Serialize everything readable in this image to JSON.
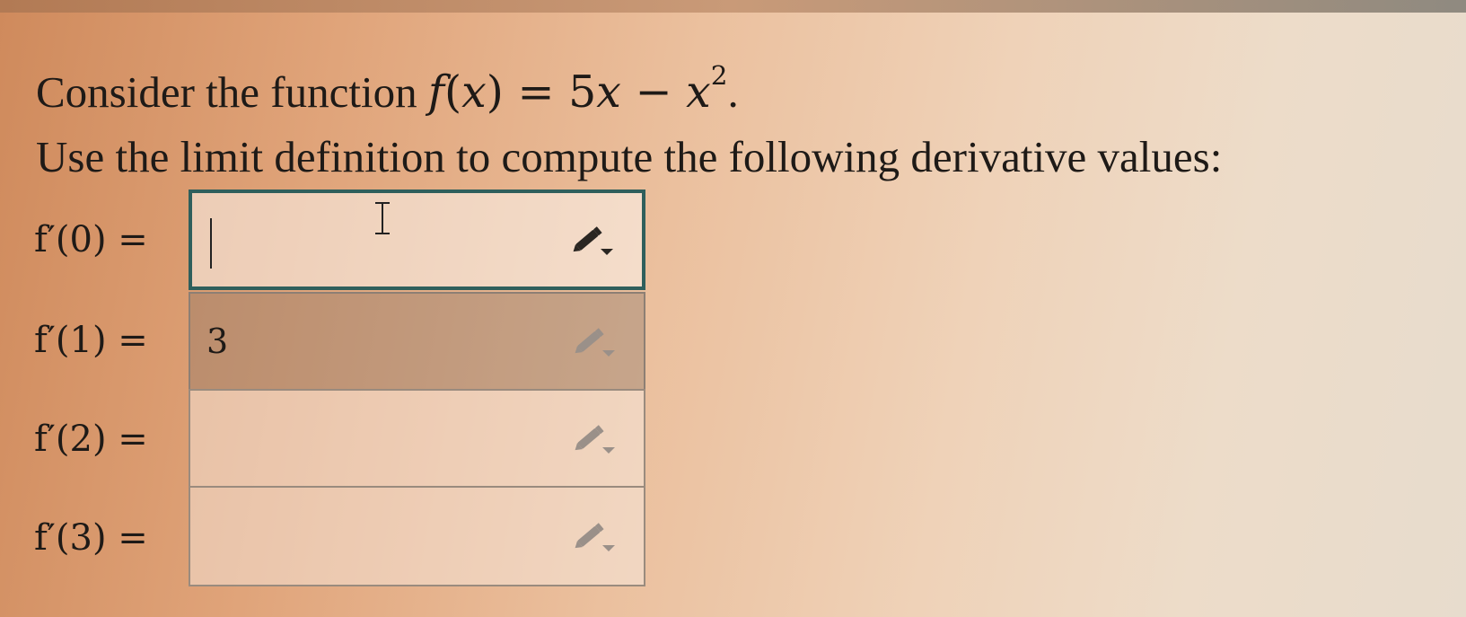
{
  "question": {
    "intro": "Consider the function ",
    "function_expr": {
      "name": "f",
      "var": "x",
      "equals": " = 5",
      "minus": " − ",
      "exponent": "2",
      "period": "."
    },
    "instruction": "Use the limit definition to compute the following derivative values:"
  },
  "rows": [
    {
      "label": "f′(0) =",
      "value": "",
      "state": "focused"
    },
    {
      "label": "f′(1) =",
      "value": "3",
      "state": "filled"
    },
    {
      "label": "f′(2) =",
      "value": "",
      "state": "empty"
    },
    {
      "label": "f′(3) =",
      "value": "",
      "state": "empty"
    }
  ],
  "icons": {
    "field_tool": "pencil-dropdown-icon",
    "cursor": "text-ibeam-cursor-icon"
  },
  "colors": {
    "focus_border": "#2f5f5c",
    "field_border": "#9a8b7e",
    "filled_background": "#a4968a",
    "pencil_active": "#2a2622",
    "pencil_disabled": "#9a9089"
  }
}
